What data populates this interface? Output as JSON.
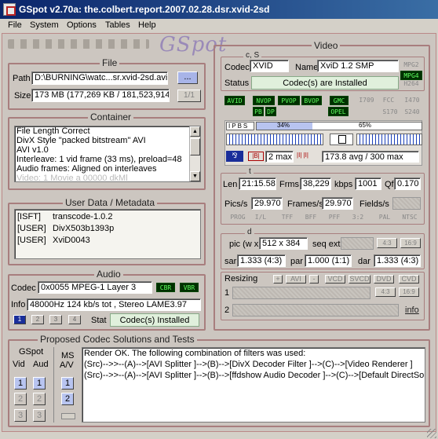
{
  "title": "GSpot v2.70a: the.colbert.report.2007.02.28.dsr.xvid-2sd",
  "menu": [
    "File",
    "System",
    "Options",
    "Tables",
    "Help"
  ],
  "logo_text": "GSpot",
  "file": {
    "group_title": "File",
    "path_label": "Path",
    "path_value": "D:\\BURNING\\watc...sr.xvid-2sd.avi",
    "browse_label": "...",
    "size_label": "Size",
    "size_value": "173 MB (177,269 KB / 181,523,914",
    "page_indicator": "1/1"
  },
  "container": {
    "group_title": "Container",
    "items": [
      "File Length Correct",
      "DivX Style \"packed bitstream\" AVI",
      "AVI v1.0",
      "Interleave: 1 vid frame (33 ms), preload=48",
      "Audio frames: Aligned on interleaves"
    ],
    "partial_item": "Video: 1 Movie a 00000 dkMl"
  },
  "userdata": {
    "group_title": "User Data / Metadata",
    "rows": [
      {
        "tag": "[ISFT]",
        "value": "transcode-1.0.2"
      },
      {
        "tag": "[USER]",
        "value": "DivX503b1393p"
      },
      {
        "tag": "[USER]",
        "value": "XviD0043"
      }
    ]
  },
  "audio": {
    "group_title": "Audio",
    "codec_label": "Codec",
    "codec_value": "0x0055 MPEG-1 Layer 3",
    "cbr": "CBR",
    "vbr": "VBR",
    "info_label": "Info",
    "info_value": "48000Hz  124 kb/s tot , Stereo LAME3.97",
    "streams": [
      "1",
      "2",
      "3",
      "4"
    ],
    "stat_label": "Stat",
    "stat_value": "Codec(s) Installed"
  },
  "video": {
    "group_title": "Video",
    "cs_label": "c, S",
    "codec_label": "Codec",
    "codec_value": "XVID",
    "name_label": "Name",
    "name_value": "XviD 1.2 SMP",
    "status_label": "Status",
    "status_value": "Codec(s) are Installed",
    "fourcc_tags": [
      "MPG2",
      "MPG4",
      "H264"
    ],
    "leds": [
      "AVID",
      "NVOP",
      "PVOP",
      "BVOP",
      "GMC",
      "PB",
      "DP",
      "OPEL"
    ],
    "std_tags": [
      "I709",
      "FCC",
      "I470",
      "S170",
      "S240"
    ],
    "ipbs": [
      "I",
      "P",
      "B",
      "S"
    ],
    "bar1_pct": "34%",
    "bar1_fraction": 0.34,
    "bar2_pct": "65%",
    "bar2_fraction": 0.65,
    "b_max": "2 max",
    "bitrate": "173.8 avg / 300 max",
    "t_label": "t",
    "len_label": "Len",
    "len_value": "21:15.58",
    "frms_label": "Frms",
    "frms_value": "38,229",
    "kbps_label": "kbps",
    "kbps_value": "1001",
    "qf_label": "Qf",
    "qf_value": "0.170",
    "pics_label": "Pics/s",
    "pics_value": "29.970",
    "frames_label": "Frames/s",
    "frames_value": "29.970",
    "fields_label": "Fields/s",
    "pulldown_tags": [
      "PROG",
      "I/L",
      "TFF",
      "BFF",
      "PFF",
      "3:2",
      "PAL",
      "NTSC"
    ],
    "d_label": "d",
    "pic_label": "pic (w x",
    "pic_value": "512 x 384",
    "seqext_label": "seq ext",
    "ar_tags": [
      "4:3",
      "16:9"
    ],
    "sar_label": "sar",
    "sar_value": "1.333 (4:3)",
    "par_label": "par",
    "par_value": "1.000 (1:1)",
    "dar_label": "dar",
    "dar_value": "1.333 (4:3)",
    "resizing_label": "Resizing",
    "resize_buttons": [
      "+",
      "AVI",
      "-",
      "VCD",
      "SVCD",
      "DVD",
      "CVD"
    ],
    "resize_tags": [
      "4:3",
      "16:9"
    ],
    "row1": "1",
    "row2": "2",
    "info_link": "info"
  },
  "proposed": {
    "group_title": "Proposed Codec Solutions and Tests",
    "gspot_label": "GSpot",
    "vid_label": "Vid",
    "aud_label": "Aud",
    "ms_label": "MS",
    "av_label": "A/V",
    "output": [
      "Render OK. The following combination of filters was used:",
      "(Src)-->>--(A)-->[AVI Splitter ]-->(B)-->[DivX Decoder Filter ]-->(C)-->[Video Renderer ]",
      "(Src)-->>--(A)-->[AVI Splitter ]-->(B)-->[ffdshow Audio Decoder ]-->(C)-->[Default DirectSound De"
    ],
    "buttons": [
      "1",
      "2",
      "3"
    ]
  },
  "colors": {
    "titlebar": "#0a246a",
    "frame": "#a87e7e",
    "led_on": "#60ff60",
    "status_green": "#e0f0dc"
  }
}
